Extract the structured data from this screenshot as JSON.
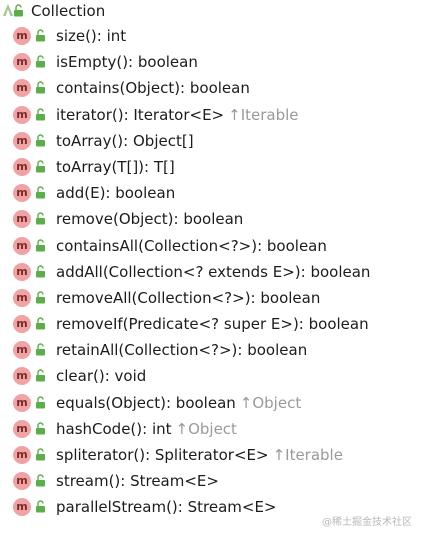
{
  "header": {
    "title": "Collection",
    "icon": "interface-icon",
    "visibility_icon": "lock-open-icon"
  },
  "colors": {
    "method_badge": "#f1a3a3",
    "method_badge_text": "#7a2b2b",
    "lock_green": "#5cae4a",
    "inherited_text": "#9a9a9a"
  },
  "badge_letter": "m",
  "methods": [
    {
      "signature": "size(): int",
      "inherited": ""
    },
    {
      "signature": "isEmpty(): boolean",
      "inherited": ""
    },
    {
      "signature": "contains(Object): boolean",
      "inherited": ""
    },
    {
      "signature": "iterator(): Iterator<E>",
      "inherited": "↑Iterable"
    },
    {
      "signature": "toArray(): Object[]",
      "inherited": ""
    },
    {
      "signature": "toArray(T[]): T[]",
      "inherited": ""
    },
    {
      "signature": "add(E): boolean",
      "inherited": ""
    },
    {
      "signature": "remove(Object): boolean",
      "inherited": ""
    },
    {
      "signature": "containsAll(Collection<?>): boolean",
      "inherited": ""
    },
    {
      "signature": "addAll(Collection<? extends E>): boolean",
      "inherited": ""
    },
    {
      "signature": "removeAll(Collection<?>): boolean",
      "inherited": ""
    },
    {
      "signature": "removeIf(Predicate<? super E>): boolean",
      "inherited": ""
    },
    {
      "signature": "retainAll(Collection<?>): boolean",
      "inherited": ""
    },
    {
      "signature": "clear(): void",
      "inherited": ""
    },
    {
      "signature": "equals(Object): boolean",
      "inherited": "↑Object"
    },
    {
      "signature": "hashCode(): int",
      "inherited": "↑Object"
    },
    {
      "signature": "spliterator(): Spliterator<E>",
      "inherited": "↑Iterable"
    },
    {
      "signature": "stream(): Stream<E>",
      "inherited": ""
    },
    {
      "signature": "parallelStream(): Stream<E>",
      "inherited": ""
    }
  ],
  "watermark": "@稀土掘金技术社区"
}
